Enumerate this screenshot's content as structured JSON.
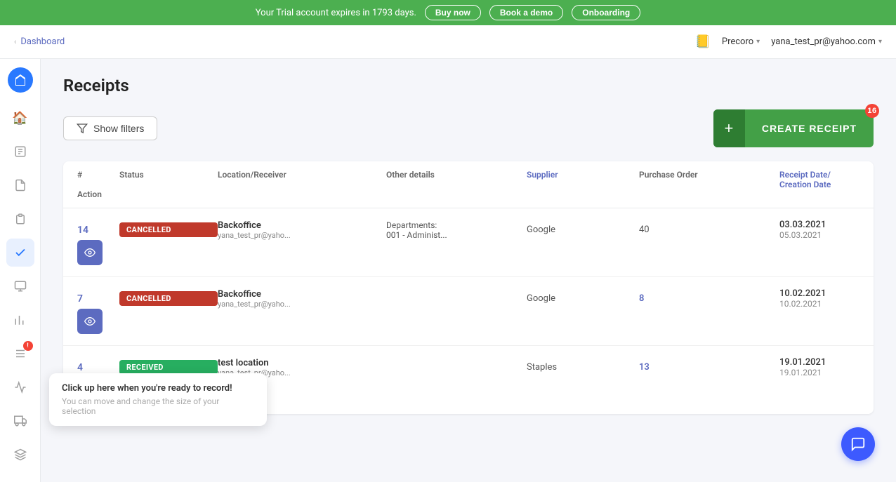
{
  "trial_banner": {
    "text": "Your Trial account expires in 1793 days.",
    "buy_now": "Buy now",
    "book_demo": "Book a demo",
    "onboarding": "Onboarding"
  },
  "top_nav": {
    "breadcrumb_parent": "Dashboard",
    "org_name": "Precoro",
    "user_email": "yana_test_pr@yahoo.com"
  },
  "sidebar": {
    "items": [
      {
        "id": "home",
        "icon": "🏠"
      },
      {
        "id": "purchase-request",
        "icon": "📋"
      },
      {
        "id": "purchase-order",
        "icon": "📄"
      },
      {
        "id": "invoice",
        "icon": "🧾"
      },
      {
        "id": "receipts",
        "icon": "✔",
        "active": true
      },
      {
        "id": "integration",
        "icon": "🔌"
      },
      {
        "id": "reports",
        "icon": "📊"
      },
      {
        "id": "list",
        "icon": "☰"
      },
      {
        "id": "analytics",
        "icon": "📈"
      },
      {
        "id": "delivery",
        "icon": "🚚"
      },
      {
        "id": "layers",
        "icon": "⊞"
      }
    ]
  },
  "page": {
    "title": "Receipts"
  },
  "toolbar": {
    "show_filters_label": "Show filters",
    "create_receipt_label": "CREATE RECEIPT",
    "notif_count": "16"
  },
  "table": {
    "headers": {
      "num": "#",
      "status": "Status",
      "location_receiver": "Location/Receiver",
      "other_details": "Other details",
      "supplier": "Supplier",
      "purchase_order": "Purchase Order",
      "receipt_date": "Receipt Date/",
      "creation_date": "Creation Date",
      "action": "Action"
    },
    "rows": [
      {
        "num": "14",
        "status": "CANCELLED",
        "status_type": "cancelled",
        "location": "Backoffice",
        "receiver": "yana_test_pr@yaho...",
        "dept_label": "Departments:",
        "dept_code": "001 - Administ...",
        "supplier": "Google",
        "purchase_order": "40",
        "purchase_order_link": false,
        "receipt_date": "03.03.2021",
        "creation_date": "05.03.2021"
      },
      {
        "num": "7",
        "status": "CANCELLED",
        "status_type": "cancelled",
        "location": "Backoffice",
        "receiver": "yana_test_pr@yaho...",
        "dept_label": "",
        "dept_code": "",
        "supplier": "Google",
        "purchase_order": "8",
        "purchase_order_link": true,
        "receipt_date": "10.02.2021",
        "creation_date": "10.02.2021"
      },
      {
        "num": "4",
        "status": "RECEIVED",
        "status_type": "received",
        "location": "test location",
        "receiver": "yana_test_pr@yaho...",
        "dept_label": "",
        "dept_code": "",
        "supplier": "Staples",
        "purchase_order": "13",
        "purchase_order_link": true,
        "receipt_date": "19.01.2021",
        "creation_date": "19.01.2021"
      }
    ]
  },
  "hint": {
    "title": "Click up here when you're ready to record!",
    "subtitle": "You can move and change the size of your selection"
  }
}
